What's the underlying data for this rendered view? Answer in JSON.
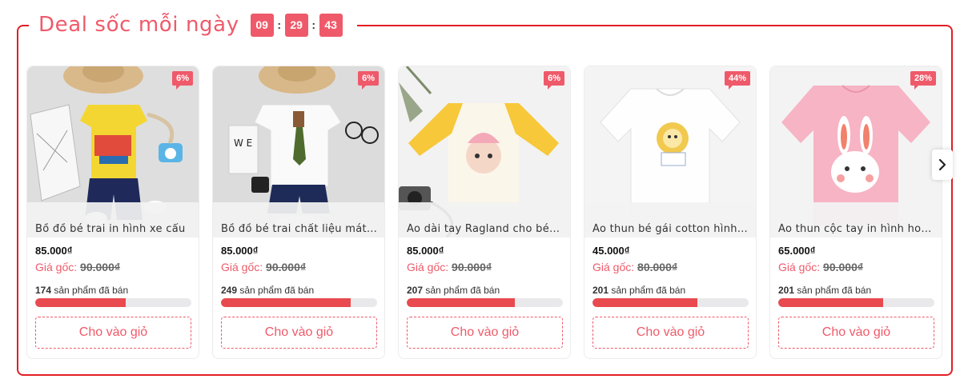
{
  "section": {
    "title": "Deal sốc mỗi ngày",
    "timer": {
      "hours": "09",
      "minutes": "29",
      "seconds": "43",
      "separator": ":"
    }
  },
  "colors": {
    "accent": "#ef5a6a",
    "border": "#e31e24",
    "progress": "#e84a4f"
  },
  "products": [
    {
      "discount": "6%",
      "name": "Bồ đồ bé trai in hình xe cẩu",
      "price": "85.000₫",
      "orig_label": "Giá gốc:",
      "orig_price": "90.000₫",
      "sold_count": "174",
      "sold_text": "sản phẩm đã bán",
      "sold_progress": 0.58,
      "button": "Cho vào giỏ"
    },
    {
      "discount": "6%",
      "name": "Bồ đồ bé trai chất liệu mát…",
      "price": "85.000₫",
      "orig_label": "Giá gốc:",
      "orig_price": "90.000₫",
      "sold_count": "249",
      "sold_text": "sản phẩm đã bán",
      "sold_progress": 0.83,
      "button": "Cho vào giỏ"
    },
    {
      "discount": "6%",
      "name": "Áo dài tay Ragland cho bé…",
      "price": "85.000₫",
      "orig_label": "Giá gốc:",
      "orig_price": "90.000₫",
      "sold_count": "207",
      "sold_text": "sản phẩm đã bán",
      "sold_progress": 0.69,
      "button": "Cho vào giỏ"
    },
    {
      "discount": "44%",
      "name": "Áo thun bé gái cotton hình…",
      "price": "45.000₫",
      "orig_label": "Giá gốc:",
      "orig_price": "80.000₫",
      "sold_count": "201",
      "sold_text": "sản phẩm đã bán",
      "sold_progress": 0.67,
      "button": "Cho vào giỏ"
    },
    {
      "discount": "28%",
      "name": "Áo thun cộc tay in hình ho…",
      "price": "65.000₫",
      "orig_label": "Giá gốc:",
      "orig_price": "90.000₫",
      "sold_count": "201",
      "sold_text": "sản phẩm đã bán",
      "sold_progress": 0.67,
      "button": "Cho vào giỏ"
    }
  ],
  "next_icon": "chevron-right-icon"
}
